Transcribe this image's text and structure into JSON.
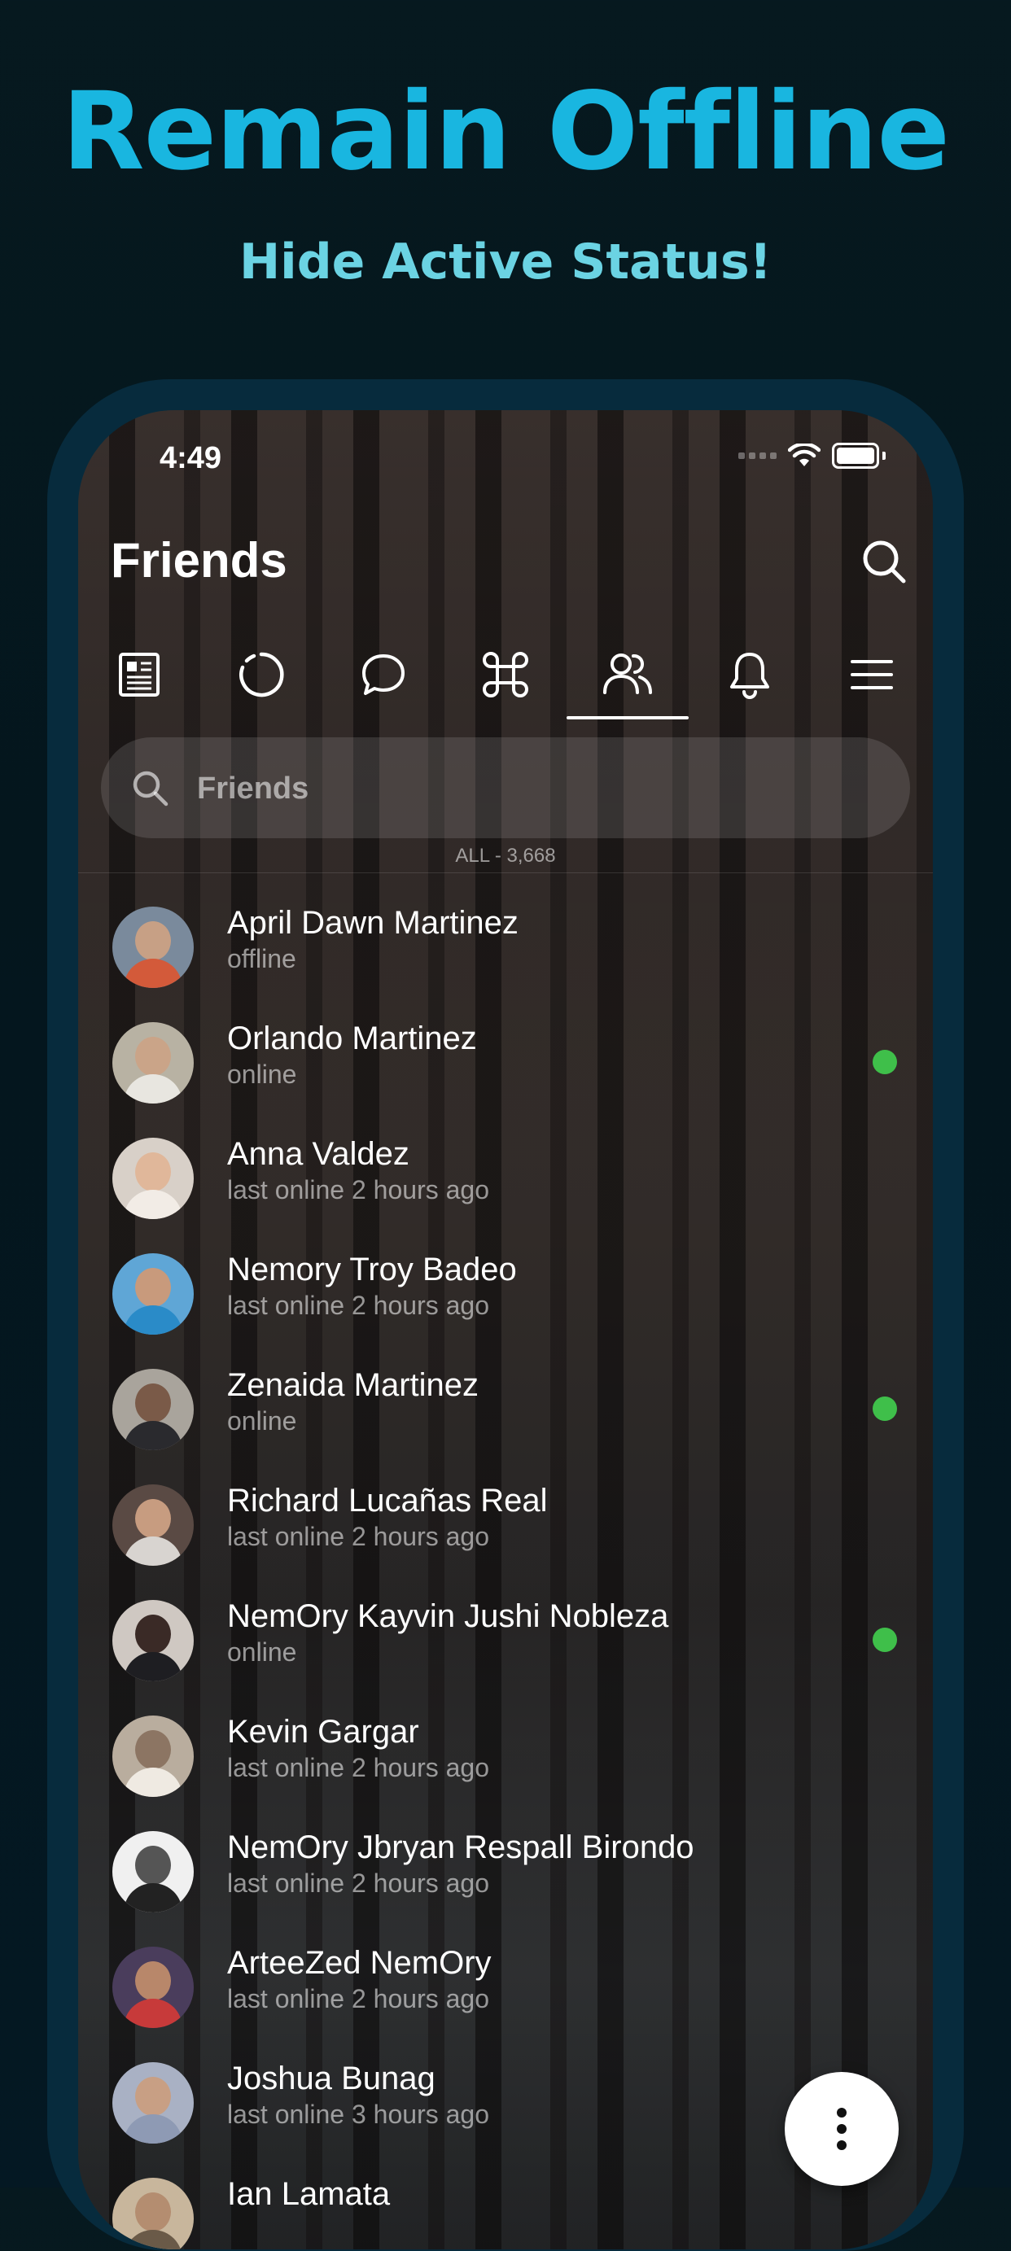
{
  "promo": {
    "headline": "Remain Offline",
    "subheadline": "Hide Active Status!"
  },
  "status_bar": {
    "time": "4:49"
  },
  "header": {
    "title": "Friends"
  },
  "tabs": [
    {
      "icon": "news-feed-icon",
      "active": false
    },
    {
      "icon": "stories-icon",
      "active": false
    },
    {
      "icon": "chat-icon",
      "active": false
    },
    {
      "icon": "command-icon",
      "active": false
    },
    {
      "icon": "friends-icon",
      "active": true
    },
    {
      "icon": "bell-icon",
      "active": false
    },
    {
      "icon": "menu-icon",
      "active": false
    }
  ],
  "search": {
    "placeholder": "Friends"
  },
  "list": {
    "count_label": "ALL - 3,668",
    "friends": [
      {
        "name": "April Dawn Martinez",
        "status": "offline",
        "online": false
      },
      {
        "name": "Orlando Martinez",
        "status": "online",
        "online": true
      },
      {
        "name": "Anna Valdez",
        "status": "last online 2 hours ago",
        "online": false
      },
      {
        "name": "Nemory Troy Badeo",
        "status": "last online 2 hours ago",
        "online": false
      },
      {
        "name": "Zenaida Martinez",
        "status": "online",
        "online": true
      },
      {
        "name": "Richard Lucañas Real",
        "status": "last online 2 hours ago",
        "online": false
      },
      {
        "name": "NemOry Kayvin Jushi Nobleza",
        "status": "online",
        "online": true
      },
      {
        "name": "Kevin Gargar",
        "status": "last online 2 hours ago",
        "online": false
      },
      {
        "name": "NemOry Jbryan Respall Birondo",
        "status": "last online 2 hours ago",
        "online": false
      },
      {
        "name": "ArteeZed NemOry",
        "status": "last online 2 hours ago",
        "online": false
      },
      {
        "name": "Joshua Bunag",
        "status": "last online 3 hours ago",
        "online": false
      },
      {
        "name": "Ian Lamata",
        "status": "",
        "online": false
      }
    ]
  },
  "colors": {
    "headline": "#19b6e0",
    "subheadline": "#6bd3e3",
    "device_frame": "#072b3d",
    "online_dot": "#3fbf4a"
  }
}
